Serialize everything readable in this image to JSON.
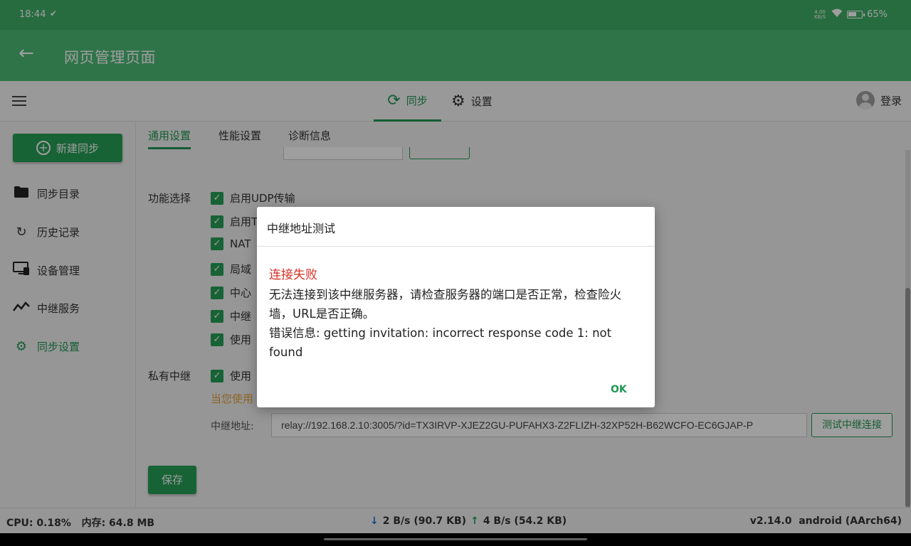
{
  "status": {
    "time": "18:44",
    "net_speed_value": "4.00",
    "net_speed_unit": "KB/S",
    "battery": "65%"
  },
  "appbar": {
    "title": "网页管理页面"
  },
  "topnav": {
    "tabs": [
      {
        "label": "同步",
        "icon": "sync-icon"
      },
      {
        "label": "设置",
        "icon": "gear-icon"
      }
    ],
    "login": "登录"
  },
  "sidebar": {
    "new_sync": "新建同步",
    "items": [
      {
        "label": "同步目录",
        "icon": "folder-icon"
      },
      {
        "label": "历史记录",
        "icon": "history-icon"
      },
      {
        "label": "设备管理",
        "icon": "devices-icon"
      },
      {
        "label": "中继服务",
        "icon": "relay-icon"
      },
      {
        "label": "同步设置",
        "icon": "gear-icon"
      }
    ]
  },
  "settings": {
    "subtabs": [
      "通用设置",
      "性能设置",
      "诊断信息"
    ],
    "feature_label": "功能选择",
    "features": [
      "启用UDP传输",
      "启用T",
      "NAT",
      "局域",
      "中心",
      "中继",
      "使用"
    ],
    "private_relay_label": "私有中继",
    "private_relay_option": "使用",
    "notice": "当您使用",
    "relay_address_label": "中继地址:",
    "relay_address": "relay://192.168.2.10:3005/?id=TX3IRVP-XJEZ2GU-PUFAHX3-Z2FLIZH-32XP52H-B62WCFO-EC6GJAP-P",
    "test_button": "测试中继连接",
    "save_button": "保存"
  },
  "dialog": {
    "title": "中继地址测试",
    "error_title": "连接失败",
    "message_1": "无法连接到该中继服务器，请检查服务器的端口是否正常，检查险火墙，URL是否正确。",
    "message_2": "错误信息: getting invitation: incorrect response code 1: not found",
    "ok": "OK"
  },
  "footer": {
    "cpu": "CPU: 0.18%",
    "memory": "内存: 64.8 MB",
    "download": "2 B/s (90.7 KB)",
    "upload": "4 B/s (54.2 KB)",
    "version": "v2.14.0",
    "platform": "android (AArch64)"
  },
  "colors": {
    "primary": "#27a057",
    "appbar": "#4cbb76",
    "statusbar": "#3fae67",
    "error": "#d93025",
    "warning": "#e6a23c"
  }
}
